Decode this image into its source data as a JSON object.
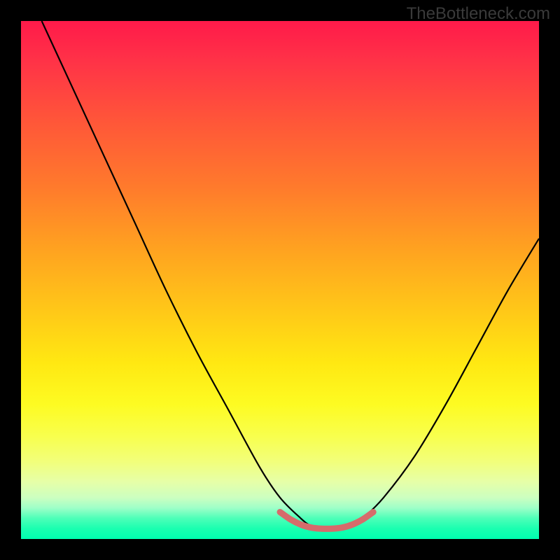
{
  "watermark": "TheBottleneck.com",
  "chart_data": {
    "type": "line",
    "title": "",
    "xlabel": "",
    "ylabel": "",
    "xlim": [
      0,
      100
    ],
    "ylim": [
      0,
      100
    ],
    "grid": false,
    "legend": false,
    "series": [
      {
        "name": "bottleneck-curve",
        "color": "#000000",
        "x": [
          4,
          10,
          16,
          22,
          28,
          34,
          40,
          46,
          50,
          54,
          56,
          58,
          60,
          62,
          64,
          66,
          70,
          76,
          82,
          88,
          94,
          100
        ],
        "values": [
          100,
          87,
          74,
          61,
          48,
          36,
          25,
          14,
          8,
          4,
          2.5,
          2,
          2,
          2,
          2.5,
          4,
          8,
          16,
          26,
          37,
          48,
          58
        ]
      },
      {
        "name": "sweet-spot-marker",
        "color": "#d66b6b",
        "x": [
          50,
          52,
          54,
          56,
          58,
          60,
          62,
          64,
          66,
          68
        ],
        "values": [
          5.2,
          3.8,
          2.8,
          2.2,
          2.0,
          2.0,
          2.2,
          2.8,
          3.8,
          5.2
        ]
      }
    ],
    "gradient_stops": [
      {
        "pos": 0,
        "color": "#ff1a4a"
      },
      {
        "pos": 20,
        "color": "#ff5838"
      },
      {
        "pos": 44,
        "color": "#ffa220"
      },
      {
        "pos": 66,
        "color": "#ffe812"
      },
      {
        "pos": 85,
        "color": "#f2ff7a"
      },
      {
        "pos": 96,
        "color": "#4dffb8"
      },
      {
        "pos": 100,
        "color": "#00ffb0"
      }
    ]
  }
}
